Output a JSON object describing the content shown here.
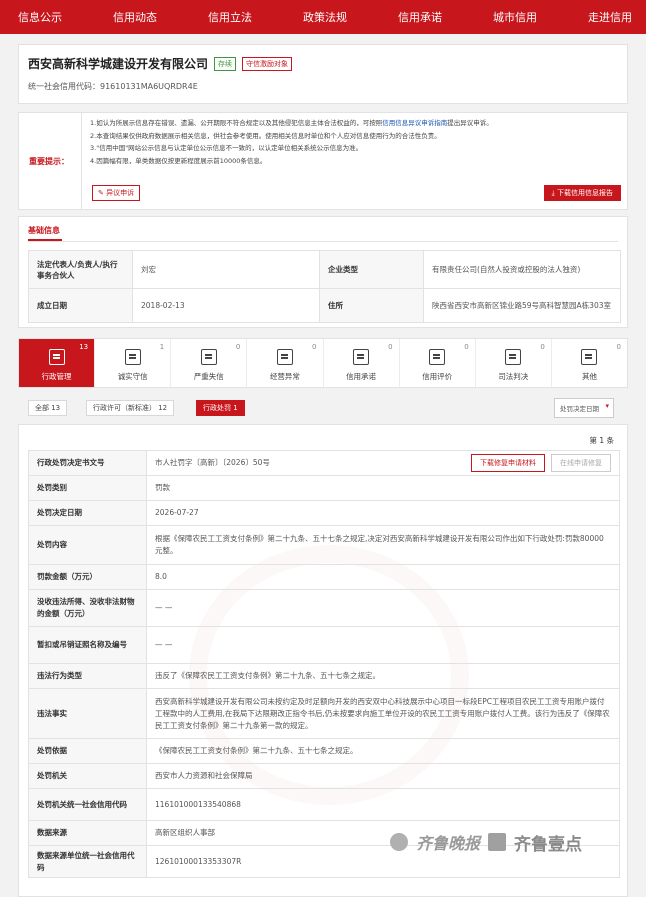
{
  "nav": {
    "items": [
      "信息公示",
      "信用动态",
      "信用立法",
      "政策法规",
      "信用承诺",
      "城市信用",
      "走进信用"
    ]
  },
  "company": {
    "name": "西安高新科学城建设开发有限公司",
    "status_badge": "存续",
    "trust_badge": "守信激励对象",
    "credit_code": "统一社会信用代码：91610131MA6UQRDR4E"
  },
  "notice": {
    "label": "重要提示：",
    "line1": "1.如认为所展示信息存在错误、遗漏、公开期限不符合规定以及其他侵犯信息主体合法权益的，可按照",
    "line1_link": "信用信息异议申诉指南",
    "line1_tail": "提出异议申诉。",
    "line2": "2.本查询结果仅供政府数据展示相关信息，供社会参考使用。使用相关信息时单位和个人应对信息使用行为的合法性负责。",
    "line3": "3.\"信用中国\"网站公示信息与认定单位公示信息不一致的，以认定单位相关系统公示信息为准。",
    "line4": "4.因篇幅有限，单类数据仅按更新程度展示前10000条信息。",
    "objection_button": "异议申诉",
    "download_button": "下载信用信息报告"
  },
  "basic": {
    "tab": "基础信息",
    "legal_rep_label": "法定代表人/负责人/执行事务合伙人",
    "legal_rep_value": "刘宏",
    "ent_type_label": "企业类型",
    "ent_type_value": "有限责任公司(自然人投资或控股的法人独资)",
    "est_date_label": "成立日期",
    "est_date_value": "2018-02-13",
    "address_label": "住所",
    "address_value": "陕西省西安市高新区锦业路59号高科智慧园A栋303室"
  },
  "categories": [
    {
      "label": "行政管理",
      "count": "13",
      "icon": "admin-doc-icon"
    },
    {
      "label": "诚实守信",
      "count": "1",
      "icon": "honesty-shield-icon"
    },
    {
      "label": "严重失信",
      "count": "0",
      "icon": "serious-dishonest-icon"
    },
    {
      "label": "经营异常",
      "count": "0",
      "icon": "alarm-bell-icon"
    },
    {
      "label": "信用承诺",
      "count": "0",
      "icon": "promise-doc-icon"
    },
    {
      "label": "信用评价",
      "count": "0",
      "icon": "evaluation-icon"
    },
    {
      "label": "司法判决",
      "count": "0",
      "icon": "judgment-icon"
    },
    {
      "label": "其他",
      "count": "0",
      "icon": "other-doc-icon"
    }
  ],
  "filters": {
    "all": "全部  13",
    "license": "行政许可（新标准）  12",
    "penalty": "行政处罚  1",
    "sort": "处罚决定日期"
  },
  "detail": {
    "page": "第 1 条",
    "download_button": "下载修复申请材料",
    "online_button": "在线申请修复",
    "rows": [
      {
        "label": "行政处罚决定书文号",
        "value": "市人社罚字〔高新〕〔2026〕50号"
      },
      {
        "label": "处罚类别",
        "value": "罚款"
      },
      {
        "label": "处罚决定日期",
        "value": "2026-07-27"
      },
      {
        "label": "处罚内容",
        "value": "根据《保障农民工工资支付条例》第二十九条、五十七条之规定,决定对西安高新科学城建设开发有限公司作出如下行政处罚:罚款80000元整。"
      },
      {
        "label": "罚款金额（万元）",
        "value": "8.0"
      },
      {
        "label": "没收违法所得、没收非法财物的金额（万元）",
        "value": "— —"
      },
      {
        "label": "暂扣或吊销证照名称及编号",
        "value": "— —"
      },
      {
        "label": "违法行为类型",
        "value": "违反了《保障农民工工资支付条例》第二十九条、五十七条之规定。"
      },
      {
        "label": "违法事实",
        "value": "西安高新科学城建设开发有限公司未按约定及时足额向开发的西安双中心科技展示中心项目一标段EPC工程项目农民工工资专用账户拨付工程款中的人工费用,在我局下达限期改正指令书后,仍未按要求向施工单位开设的农民工工资专用账户拨付人工费。该行为违反了《保障农民工工资支付条例》第二十九条第一款的规定。"
      },
      {
        "label": "处罚依据",
        "value": "《保障农民工工资支付条例》第二十九条、五十七条之规定。"
      },
      {
        "label": "处罚机关",
        "value": "西安市人力资源和社会保障局"
      },
      {
        "label": "处罚机关统一社会信用代码",
        "value": "116101000133540868"
      },
      {
        "label": "数据来源",
        "value": "高新区组织人事部"
      },
      {
        "label": "数据来源单位统一社会信用代码",
        "value": "12610100013353307R"
      }
    ]
  },
  "footer": {
    "logo1": "齐鲁晚报",
    "logo2": "齐鲁壹点"
  }
}
